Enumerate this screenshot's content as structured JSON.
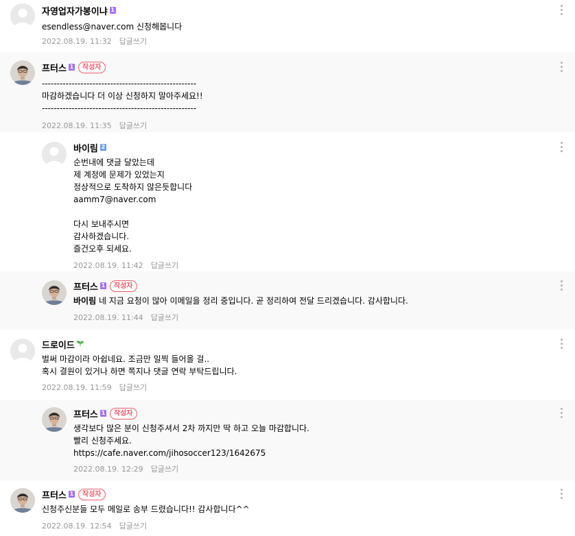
{
  "colors": {
    "level_purple": "#a470f2",
    "level_blue": "#6e9cf6",
    "author_badge": "#f25b6b",
    "meta_gray": "#979797",
    "shaded_bg": "#f9f9fa",
    "sprout_green": "#4cb04c"
  },
  "icons": {
    "more": "kebab-menu-icon",
    "default_avatar": "default-profile-icon",
    "author_avatar": "profile-photo",
    "level_badge": "level-icon",
    "sprout": "sprout-icon"
  },
  "comments": [
    {
      "nickname": "자영업자가봉이냐",
      "level": "1",
      "lines": [
        "esendless@naver.com 신청해봅니다"
      ],
      "date": "2022.08.19. 11:32",
      "reply_label": "답글쓰기"
    },
    {
      "nickname": "프터스",
      "level": "1",
      "author_badge": "작성자",
      "lines": [
        "----------------------------------------------------",
        "마감하겠습니다 더 이상 신청하지 말아주세요!!",
        "----------------------------------------------------"
      ],
      "date": "2022.08.19. 11:35",
      "reply_label": "답글쓰기"
    },
    {
      "nickname": "바이림",
      "level": "2",
      "lines": [
        "순번내에 댓글 달았는데",
        "제 계정에 문제가 있었는지",
        "정상적으로 도착하지 않은듯합니다",
        "aamm7@naver.com",
        "",
        "다시 보내주시면",
        "감사하겠습니다.",
        "즐건오후 되세요."
      ],
      "date": "2022.08.19. 11:42",
      "reply_label": "답글쓰기"
    },
    {
      "nickname": "프터스",
      "level": "1",
      "author_badge": "작성자",
      "mention": "바이림",
      "text": "네 지금 요청이 많아 이메일을 정리 중입니다. 곧 정리하여 전달 드리겠습니다. 감사합니다.",
      "date": "2022.08.19. 11:44",
      "reply_label": "답글쓰기"
    },
    {
      "nickname": "드로이드",
      "lines": [
        "벌써 마감이라 아쉽네요. 조금만 일찍 들어올 걸..",
        "혹시 결원이 있거나 하면 쪽지나 댓글 연락 부탁드립니다."
      ],
      "date": "2022.08.19. 11:59",
      "reply_label": "답글쓰기"
    },
    {
      "nickname": "프터스",
      "level": "1",
      "author_badge": "작성자",
      "lines": [
        "생각보다 많은 분이 신청주셔서 2차 까지만 딱 하고 오늘 마감합니다.",
        "빨리 신청주세요.",
        "https://cafe.naver.com/jihosoccer123/1642675"
      ],
      "date": "2022.08.19. 12:29",
      "reply_label": "답글쓰기"
    },
    {
      "nickname": "프터스",
      "level": "1",
      "author_badge": "작성자",
      "lines": [
        "신청주신분들 모두 메일로 송부 드렸습니다!! 감사합니다^^"
      ],
      "date": "2022.08.19. 12:54",
      "reply_label": "답글쓰기"
    }
  ]
}
